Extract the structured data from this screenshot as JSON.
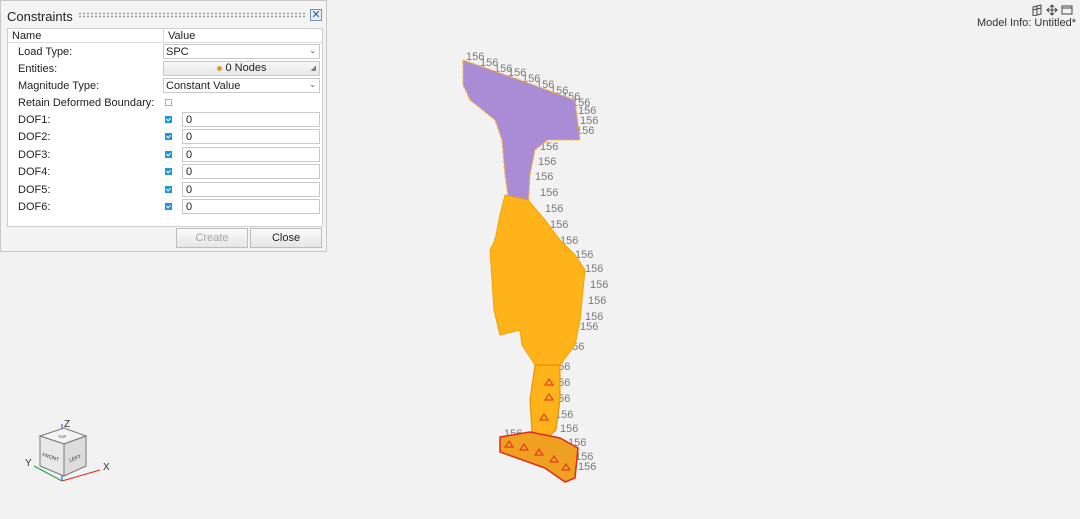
{
  "panel": {
    "title": "Constraints",
    "columns": {
      "name": "Name",
      "value": "Value"
    },
    "rows": {
      "load_type": {
        "label": "Load Type:",
        "value": "SPC"
      },
      "entities": {
        "label": "Entities:",
        "value": "0 Nodes"
      },
      "magnitude_type": {
        "label": "Magnitude Type:",
        "value": "Constant Value"
      },
      "retain": {
        "label": "Retain Deformed Boundary:",
        "checked": false
      }
    },
    "dofs": [
      {
        "label": "DOF1:",
        "value": "0",
        "checked": true
      },
      {
        "label": "DOF2:",
        "value": "0",
        "checked": true
      },
      {
        "label": "DOF3:",
        "value": "0",
        "checked": true
      },
      {
        "label": "DOF4:",
        "value": "0",
        "checked": true
      },
      {
        "label": "DOF5:",
        "value": "0",
        "checked": true
      },
      {
        "label": "DOF6:",
        "value": "0",
        "checked": true
      }
    ],
    "buttons": {
      "create": "Create",
      "close": "Close"
    }
  },
  "model_info": "Model Info: Untitled*",
  "icons": {
    "close": "close-icon",
    "dropdown": "chevron-down-icon",
    "grid": "grid-icon",
    "move": "move-icon",
    "window": "window-icon",
    "view_cube": "view-cube-icon"
  },
  "view_cube": {
    "front": "FRONT",
    "left": "LEFT",
    "top": "TOP",
    "x": "X",
    "y": "Y",
    "z": "Z"
  },
  "colors": {
    "mesh_orange": "#ffb31a",
    "mesh_purple": "#a98bd6",
    "constraint_red": "#e0281e",
    "label_gray": "#777777",
    "accent": "#1b98d6"
  },
  "node_label": "156"
}
